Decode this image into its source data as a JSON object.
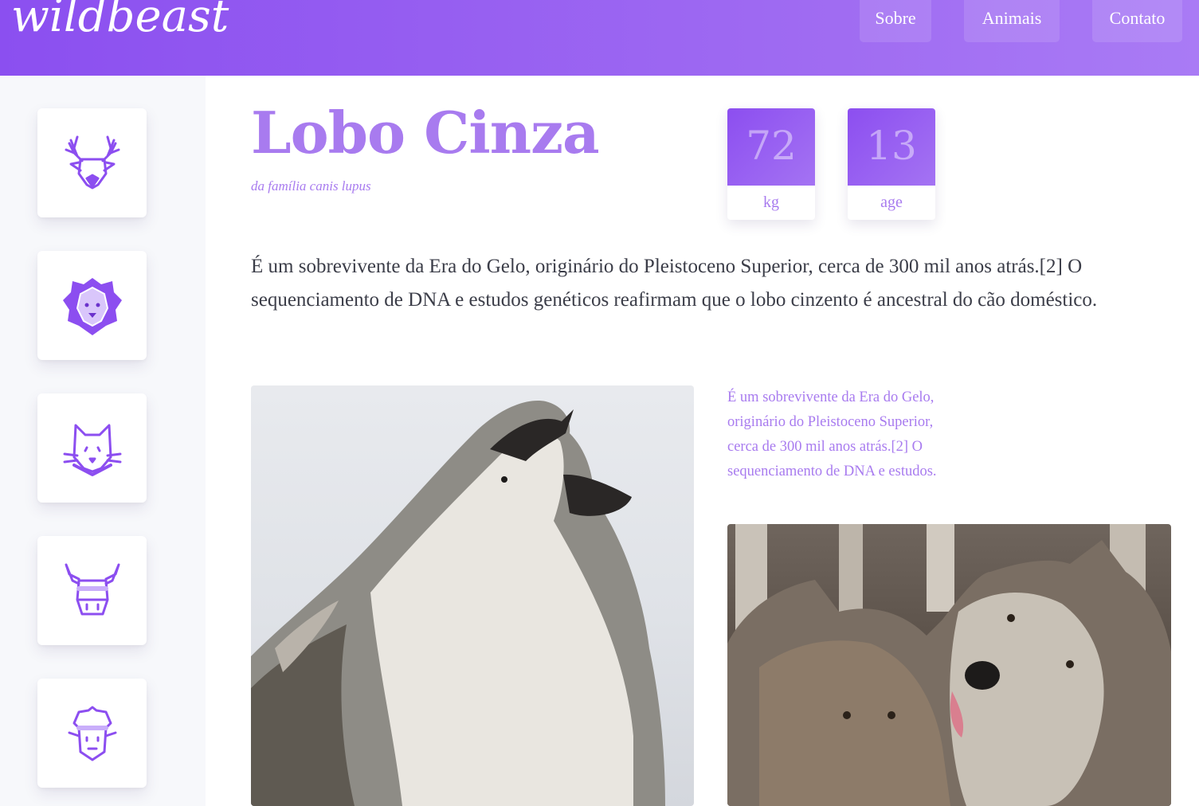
{
  "header": {
    "logo": "wildbeast",
    "nav": [
      {
        "label": "Sobre"
      },
      {
        "label": "Animais"
      },
      {
        "label": "Contato"
      }
    ]
  },
  "sidebar": {
    "items": [
      {
        "icon": "deer-icon"
      },
      {
        "icon": "lion-icon"
      },
      {
        "icon": "cat-icon"
      },
      {
        "icon": "bull-icon"
      },
      {
        "icon": "sheep-icon"
      }
    ]
  },
  "animal": {
    "name": "Lobo Cinza",
    "family": "da família canis lupus",
    "stats": [
      {
        "value": "72",
        "unit": "kg"
      },
      {
        "value": "13",
        "unit": "age"
      }
    ],
    "description": "É um sobrevivente da Era do Gelo, originário do Pleistoceno Superior, cerca de 300 mil anos atrás.[2] O sequenciamento de DNA e estudos genéticos reafirmam que o lobo cinzento é ancestral do cão doméstico.",
    "side_text": "É um sobrevivente da Era do Gelo, originário do Pleistoceno Superior, cerca de 300 mil anos atrás.[2] O sequenciamento de DNA e estudos."
  },
  "photos": [
    {
      "subject": "howling-wolf-photo"
    },
    {
      "subject": "wolf-pair-photo"
    }
  ],
  "colors": {
    "accent": "#a87bef",
    "header_start": "#8b4ff0",
    "header_end": "#a97bf5",
    "icon_stroke": "#8c4ef0",
    "body_text": "#3b3d48"
  }
}
